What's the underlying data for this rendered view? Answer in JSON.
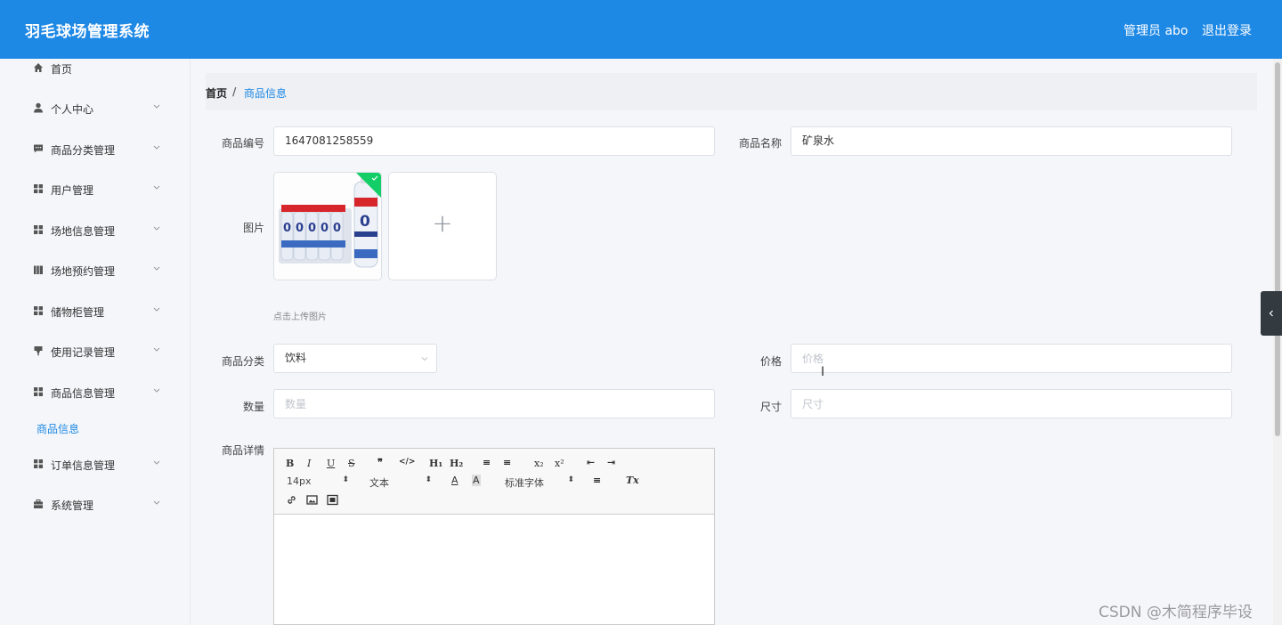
{
  "header": {
    "title": "羽毛球场管理系统",
    "user": "管理员 abo",
    "logout": "退出登录"
  },
  "sidebar": {
    "items": [
      {
        "label": "首页",
        "icon": "home-icon",
        "has_children": false
      },
      {
        "label": "个人中心",
        "icon": "user-icon",
        "has_children": true
      },
      {
        "label": "商品分类管理",
        "icon": "message-icon",
        "has_children": true
      },
      {
        "label": "用户管理",
        "icon": "grid-icon",
        "has_children": true
      },
      {
        "label": "场地信息管理",
        "icon": "grid-icon",
        "has_children": true
      },
      {
        "label": "场地预约管理",
        "icon": "book-icon",
        "has_children": true
      },
      {
        "label": "储物柜管理",
        "icon": "grid-icon",
        "has_children": true
      },
      {
        "label": "使用记录管理",
        "icon": "cup-icon",
        "has_children": true
      },
      {
        "label": "商品信息管理",
        "icon": "grid-icon",
        "has_children": true
      },
      {
        "label": "订单信息管理",
        "icon": "grid-icon",
        "has_children": true
      },
      {
        "label": "系统管理",
        "icon": "briefcase-icon",
        "has_children": true
      }
    ],
    "active_sub": "商品信息"
  },
  "breadcrumb": {
    "home": "首页",
    "separator": "/",
    "current": "商品信息"
  },
  "form": {
    "code_label": "商品编号",
    "code_value": "1647081258559",
    "name_label": "商品名称",
    "name_value": "矿泉水",
    "image_label": "图片",
    "upload_hint": "点击上传图片",
    "upload_plus": "+",
    "category_label": "商品分类",
    "category_value": "饮料",
    "price_label": "价格",
    "price_placeholder": "价格",
    "quantity_label": "数量",
    "quantity_placeholder": "数量",
    "size_label": "尺寸",
    "size_placeholder": "尺寸",
    "detail_label": "商品详情"
  },
  "editor": {
    "font_size": "14px",
    "header_select": "文本",
    "font_family": "标准字体",
    "buttons": {
      "bold": "B",
      "italic": "I",
      "underline": "U",
      "strike": "S",
      "quote": "❞",
      "code": "</>",
      "h1": "H₁",
      "h2": "H₂",
      "ordered": "≡",
      "bullet": "≡",
      "sub": "x₂",
      "sup": "x²",
      "outdent": "⇤",
      "indent": "⇥",
      "color": "A",
      "background": "A",
      "align": "≡",
      "clean": "Tx"
    }
  },
  "watermark": "CSDN @木简程序毕设",
  "colors": {
    "primary": "#1e88e5",
    "success": "#13ce66"
  }
}
